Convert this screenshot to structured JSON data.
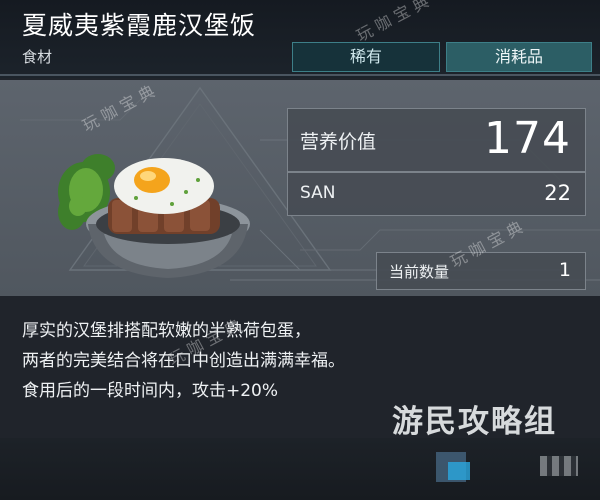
{
  "item": {
    "name": "夏威夷紫霞鹿汉堡饭",
    "category": "食材",
    "tags": {
      "rarity": "稀有",
      "type": "消耗品"
    }
  },
  "stats": {
    "nutrition": {
      "label": "营养价值",
      "value": "174"
    },
    "san": {
      "label": "SAN",
      "value": "22"
    },
    "count": {
      "label": "当前数量",
      "value": "1"
    }
  },
  "description": {
    "lines": [
      "厚实的汉堡排搭配软嫩的半熟荷包蛋，",
      "两者的完美结合将在口中创造出满满幸福。",
      "食用后的一段时间内，攻击+20%"
    ]
  },
  "watermarks": {
    "brand": "游民攻略组",
    "site": "玩咖宝典"
  },
  "icon": "hamburger-rice-bowl-icon",
  "colors": {
    "accent": "#3d7f88",
    "panel": "#464c54"
  }
}
